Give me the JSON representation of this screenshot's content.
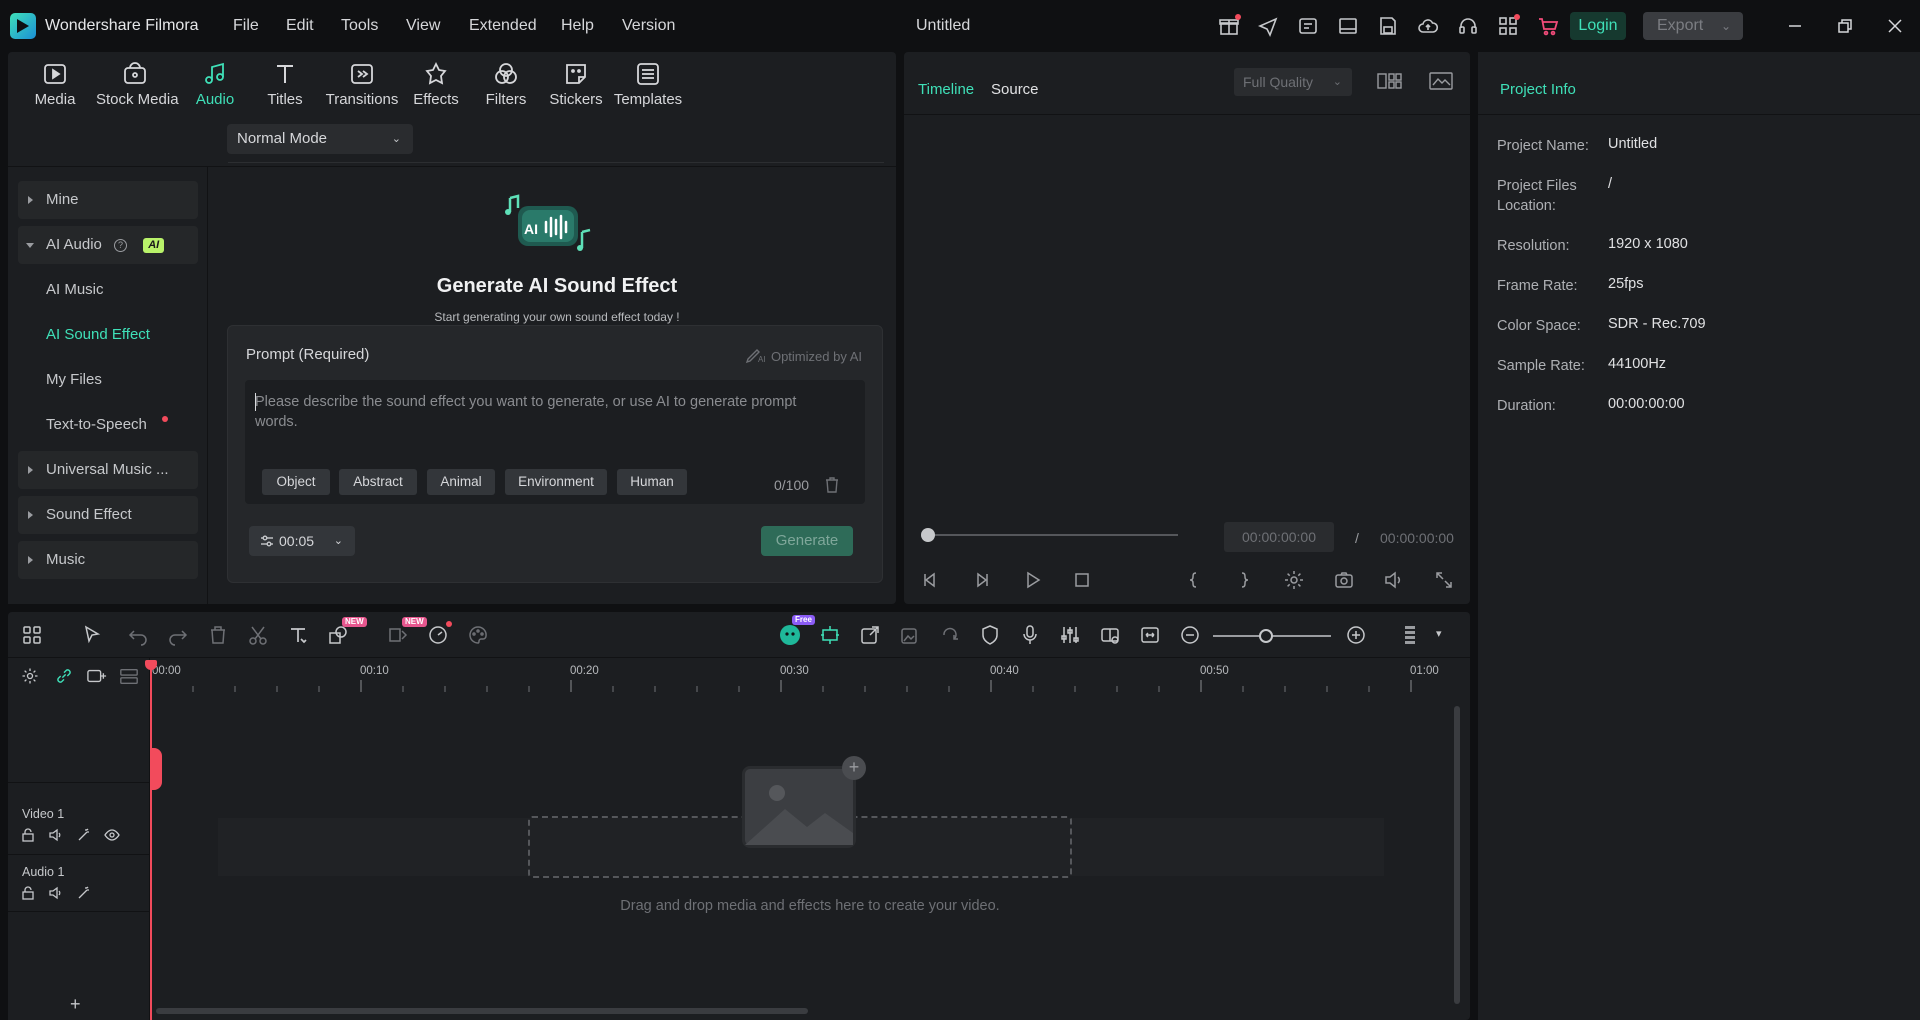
{
  "titlebar": {
    "app_name": "Wondershare Filmora",
    "menus": [
      "File",
      "Edit",
      "Tools",
      "View",
      "Extended",
      "Help",
      "Version"
    ],
    "window_title": "Untitled",
    "login_label": "Login",
    "export_label": "Export"
  },
  "library": {
    "tabs": [
      "Media",
      "Stock Media",
      "Audio",
      "Titles",
      "Transitions",
      "Effects",
      "Filters",
      "Stickers",
      "Templates"
    ],
    "active_tab": "Audio"
  },
  "sidebar": {
    "mine": "Mine",
    "ai_audio": "AI Audio",
    "ai_badge": "AI",
    "ai_music": "AI Music",
    "ai_sound_effect": "AI Sound Effect",
    "my_files": "My Files",
    "text_to_speech": "Text-to-Speech",
    "universal_music": "Universal Music ...",
    "sound_effect": "Sound Effect",
    "music": "Music"
  },
  "generator": {
    "mode": "Normal Mode",
    "title": "Generate AI Sound Effect",
    "subtitle": "Start generating your own sound effect today !",
    "prompt_label": "Prompt (Required)",
    "optimized": "Optimized by AI",
    "placeholder": "Please describe the sound effect you want to generate, or use AI to generate prompt words.",
    "chips": [
      "Object",
      "Abstract",
      "Animal",
      "Environment",
      "Human"
    ],
    "counter": "0/100",
    "duration": "00:05",
    "generate_label": "Generate"
  },
  "preview": {
    "tab_timeline": "Timeline",
    "tab_source": "Source",
    "quality": "Full Quality",
    "current_time": "00:00:00:00",
    "separator": "/",
    "total_time": "00:00:00:00"
  },
  "project_info": {
    "title": "Project Info",
    "rows": [
      {
        "key": "Project Name:",
        "value": "Untitled"
      },
      {
        "key": "Project Files Location:",
        "value": "/"
      },
      {
        "key": "Resolution:",
        "value": "1920 x 1080"
      },
      {
        "key": "Frame Rate:",
        "value": "25fps"
      },
      {
        "key": "Color Space:",
        "value": "SDR - Rec.709"
      },
      {
        "key": "Sample Rate:",
        "value": "44100Hz"
      },
      {
        "key": "Duration:",
        "value": "00:00:00:00"
      }
    ]
  },
  "timeline": {
    "new_tag": "NEW",
    "free_tag": "Free",
    "ruler": [
      "00:00",
      "00:10",
      "00:20",
      "00:30",
      "00:40",
      "00:50",
      "01:00"
    ],
    "tracks": [
      "Video 1",
      "Audio 1"
    ],
    "drop_text": "Drag and drop media and effects here to create your video.",
    "add_track": "+"
  },
  "colors": {
    "accent": "#3fe0b8",
    "panel": "#1c1e21",
    "background": "#0f1012",
    "playhead": "#f24b5c"
  }
}
